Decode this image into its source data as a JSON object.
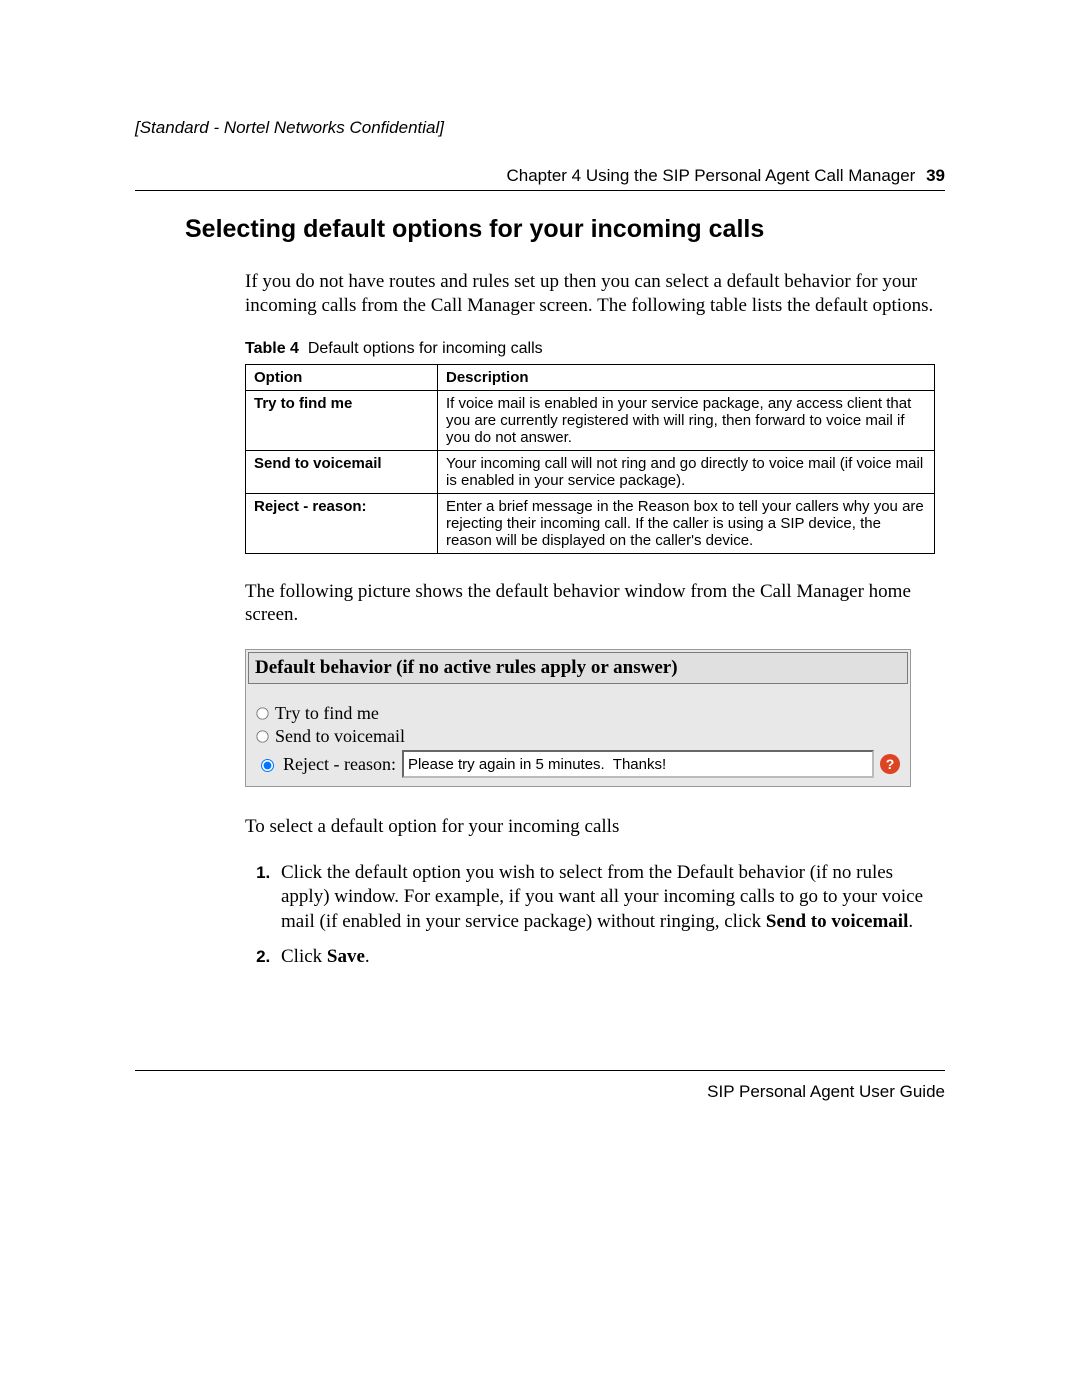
{
  "header": {
    "confidential": "[Standard - Nortel Networks Confidential]",
    "chapter": "Chapter 4  Using the SIP Personal Agent Call Manager",
    "page_number": "39"
  },
  "section_title": "Selecting default options for your incoming calls",
  "intro_paragraph": "If you do not have routes and rules set up then you can select a default behavior for your incoming calls from the Call Manager screen. The following table lists the default options.",
  "table": {
    "caption_label": "Table 4",
    "caption_text": "Default options for incoming calls",
    "head_option": "Option",
    "head_description": "Description",
    "rows": [
      {
        "option": "Try to find me",
        "description": "If voice mail is enabled in your service package, any access client that you are currently registered with will ring, then forward to voice mail if you do not answer."
      },
      {
        "option": "Send to voicemail",
        "description": "Your incoming call will not ring and go directly to voice mail (if voice mail is enabled in your service package)."
      },
      {
        "option": "Reject - reason:",
        "description": "Enter a brief message in the Reason box to tell your callers why you are rejecting their incoming call. If the caller is using a SIP device, the reason will be displayed on the caller's device."
      }
    ]
  },
  "mid_paragraph": "The following picture shows the default behavior window from the Call Manager home screen.",
  "screenshot": {
    "title": "Default behavior (if no active rules apply or answer)",
    "options": {
      "try_find": "Try to find me",
      "voicemail": "Send to voicemail",
      "reject_label": "Reject - reason:"
    },
    "reason_value": "Please try again in 5 minutes.  Thanks!",
    "help_glyph": "?"
  },
  "instruction_lead": "To select a default option for your incoming calls",
  "steps": {
    "s1_a": "Click the default option you wish to select from the Default behavior (if no rules apply) window. For example, if you want all your incoming calls to go to your voice mail (if enabled in your service package) without ringing, click ",
    "s1_b": "Send to voicemail",
    "s1_c": ".",
    "s2_a": "Click ",
    "s2_b": "Save",
    "s2_c": "."
  },
  "footer": "SIP Personal Agent User Guide"
}
